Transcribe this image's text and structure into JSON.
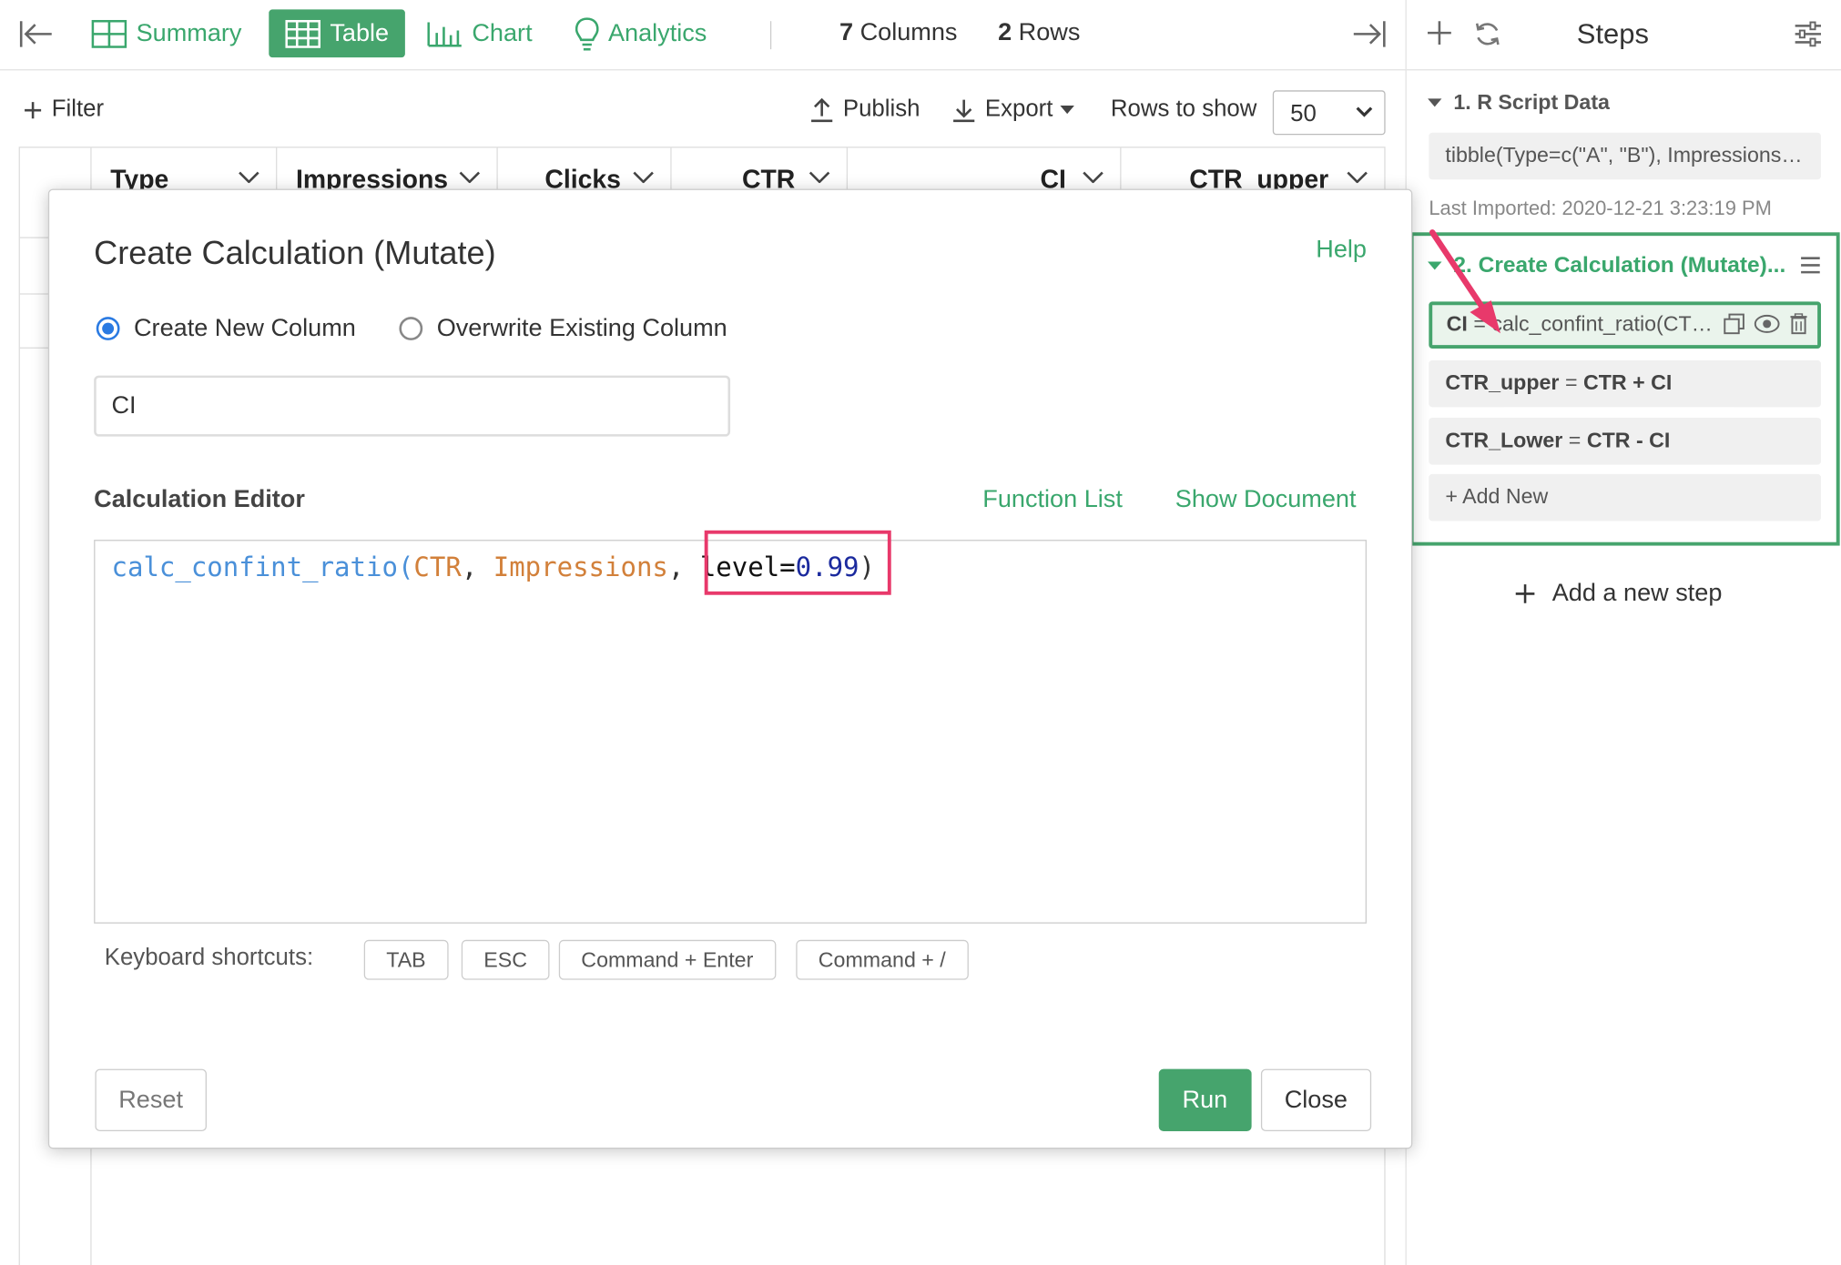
{
  "toolbar": {
    "tabs": [
      {
        "label": "Summary",
        "icon": "summary-grid-icon"
      },
      {
        "label": "Table",
        "icon": "table-grid-icon",
        "active": true
      },
      {
        "label": "Chart",
        "icon": "bar-chart-icon"
      },
      {
        "label": "Analytics",
        "icon": "lightbulb-icon"
      }
    ],
    "columns_count": "7",
    "columns_label": "Columns",
    "rows_count": "2",
    "rows_label": "Rows"
  },
  "filterbar": {
    "filter_label": "Filter",
    "publish_label": "Publish",
    "export_label": "Export",
    "rows_to_show_label": "Rows to show",
    "rows_to_show_value": "50"
  },
  "table": {
    "headers": [
      "Type",
      "Impressions",
      "Clicks",
      "CTR",
      "CI",
      "CTR_upper"
    ]
  },
  "steps": {
    "title": "Steps",
    "step1": {
      "title": "1. R Script Data",
      "code": "tibble(Type=c(\"A\", \"B\"), Impressions=c(...",
      "last_imported": "Last Imported: 2020-12-21 3:23:19 PM"
    },
    "step2": {
      "title": "2. Create Calculation (Mutate)...",
      "items": [
        {
          "col": "CI",
          "op": "=",
          "expr": "calc_confint_ratio(CT…"
        },
        {
          "col": "CTR_upper",
          "op": "=",
          "expr": "CTR + CI"
        },
        {
          "col": "CTR_Lower",
          "op": "=",
          "expr": "CTR - CI"
        }
      ],
      "add_new": "Add New"
    },
    "add_step": "Add a new step"
  },
  "modal": {
    "title": "Create Calculation (Mutate)",
    "help": "Help",
    "radio_new": "Create New Column",
    "radio_overwrite": "Overwrite Existing Column",
    "column_name": "CI",
    "editor_label": "Calculation Editor",
    "function_list": "Function List",
    "show_document": "Show Document",
    "code": {
      "fn": "calc_confint_ratio",
      "open": "(",
      "arg1": "CTR",
      "comma1": ", ",
      "arg2": "Impressions",
      "comma2": ", ",
      "key": "level=",
      "num": "0.99",
      "close": ")"
    },
    "shortcuts_label": "Keyboard shortcuts:",
    "shortcuts": [
      "TAB",
      "ESC",
      "Command + Enter",
      "Command + /"
    ],
    "reset": "Reset",
    "run": "Run",
    "close": "Close"
  },
  "colors": {
    "accent_green": "#46a46d",
    "highlight_pink": "#e8396b",
    "code_function_blue": "#4a90d9",
    "code_arg_orange": "#d2803a"
  }
}
